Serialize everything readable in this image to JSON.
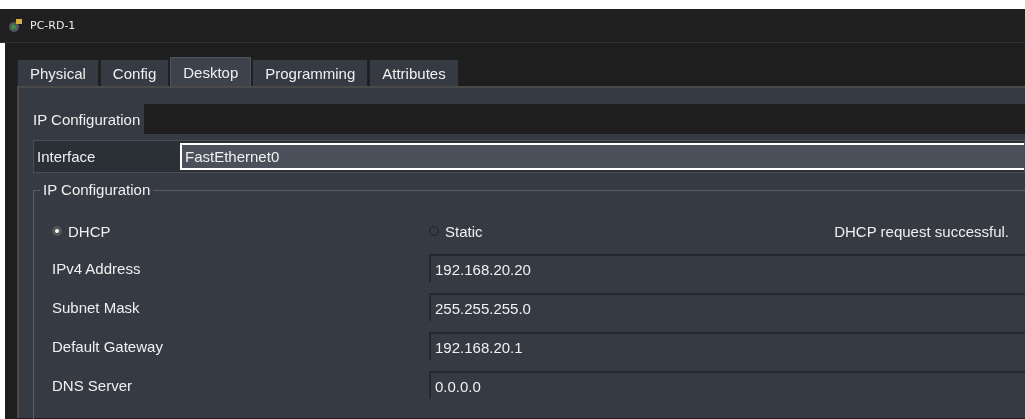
{
  "window": {
    "title": "PC-RD-1"
  },
  "tabs": [
    {
      "label": "Physical",
      "selected": false
    },
    {
      "label": "Config",
      "selected": false
    },
    {
      "label": "Desktop",
      "selected": true
    },
    {
      "label": "Programming",
      "selected": false
    },
    {
      "label": "Attributes",
      "selected": false
    }
  ],
  "section_title": "IP Configuration",
  "interface": {
    "label": "Interface",
    "value": "FastEthernet0"
  },
  "group": {
    "title": "IP Configuration",
    "modes": [
      {
        "label": "DHCP",
        "selected": true
      },
      {
        "label": "Static",
        "selected": false
      }
    ],
    "status": "DHCP request successful.",
    "fields": [
      {
        "label": "IPv4 Address",
        "value": "192.168.20.20"
      },
      {
        "label": "Subnet Mask",
        "value": "255.255.255.0"
      },
      {
        "label": "Default Gateway",
        "value": "192.168.20.1"
      },
      {
        "label": "DNS Server",
        "value": "0.0.0.0"
      }
    ]
  }
}
